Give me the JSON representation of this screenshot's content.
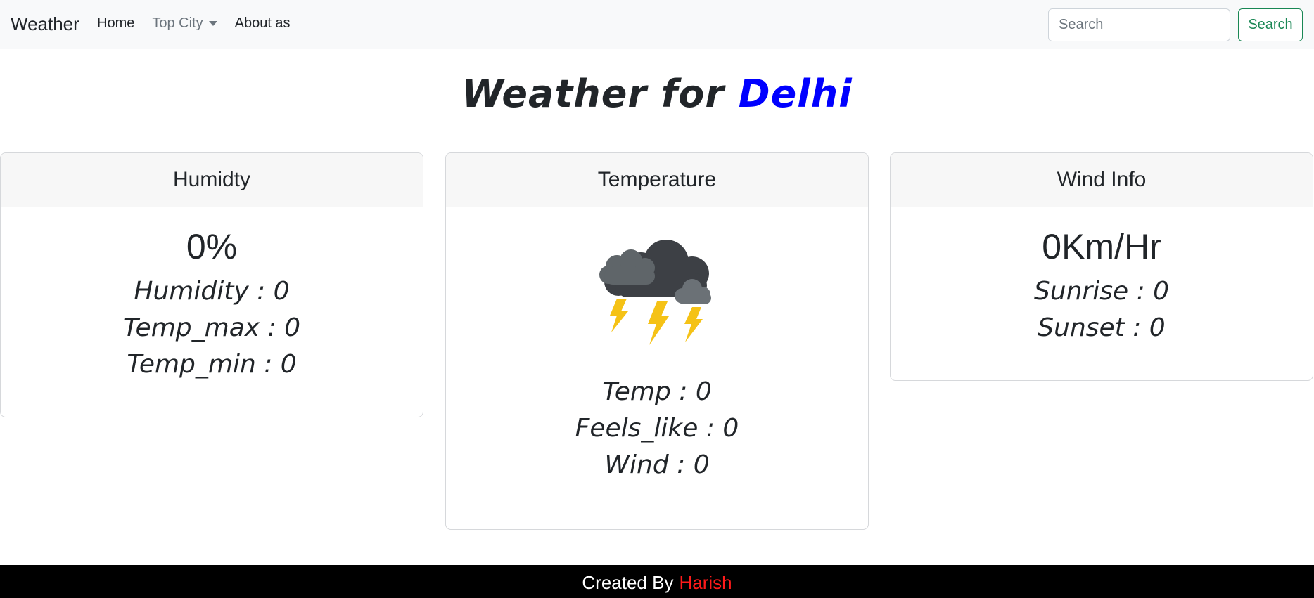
{
  "navbar": {
    "brand": "Weather",
    "links": [
      {
        "label": "Home"
      },
      {
        "label": "Top City"
      },
      {
        "label": "About as"
      }
    ],
    "search_placeholder": "Search",
    "search_button": "Search"
  },
  "title": {
    "prefix": "Weather for",
    "city": "Delhi"
  },
  "humidity_card": {
    "header": "Humidty",
    "value": "0%",
    "stats": [
      "Humidity : 0",
      "Temp_max : 0",
      "Temp_min : 0"
    ]
  },
  "temperature_card": {
    "header": "Temperature",
    "icon": "thunderstorm-icon",
    "stats": [
      "Temp : 0",
      "Feels_like : 0",
      "Wind : 0"
    ]
  },
  "wind_card": {
    "header": "Wind Info",
    "value": "0Km/Hr",
    "stats": [
      "Sunrise : 0",
      "Sunset : 0"
    ]
  },
  "footer": {
    "prefix": "Created By",
    "author": "Harish"
  },
  "colors": {
    "city": "#0000ff",
    "author": "#ff1a1a",
    "search_button": "#198754",
    "navbar_bg": "#f8f9fa",
    "footer_bg": "#000000"
  }
}
